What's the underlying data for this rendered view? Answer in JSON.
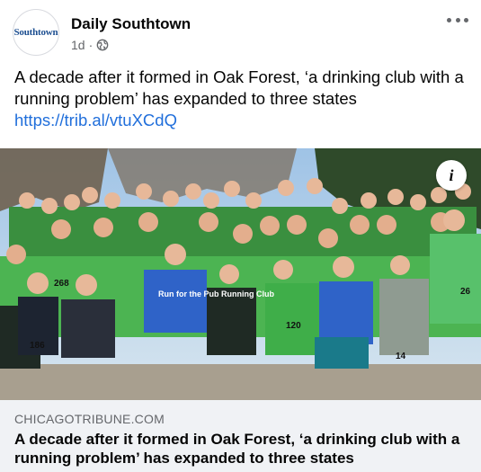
{
  "post": {
    "page_name": "Daily Southtown",
    "avatar_text": "Southtown",
    "timestamp": "1d",
    "separator": "·",
    "caption_text": "A decade after it formed in Oak Forest, ‘a drinking club with a running problem’ has expanded to three states",
    "caption_link": "https://trib.al/vtuXCdQ"
  },
  "photo": {
    "info_glyph": "i",
    "shirt_texts": [
      "Run for the Pub Running Club",
      "186",
      "268",
      "120",
      "26",
      "14"
    ]
  },
  "link_card": {
    "domain": "CHICAGOTRIBUNE.COM",
    "title": "A decade after it formed in Oak Forest, ‘a drinking club with a running problem’ has expanded to three states"
  },
  "colors": {
    "link": "#216fdb",
    "meta": "#65676b",
    "card_bg": "#f0f2f5",
    "shirt_green": "#3fae49",
    "shirt_blue": "#2f63c8"
  },
  "icons": [
    "globe-icon",
    "more-icon",
    "info-icon"
  ]
}
